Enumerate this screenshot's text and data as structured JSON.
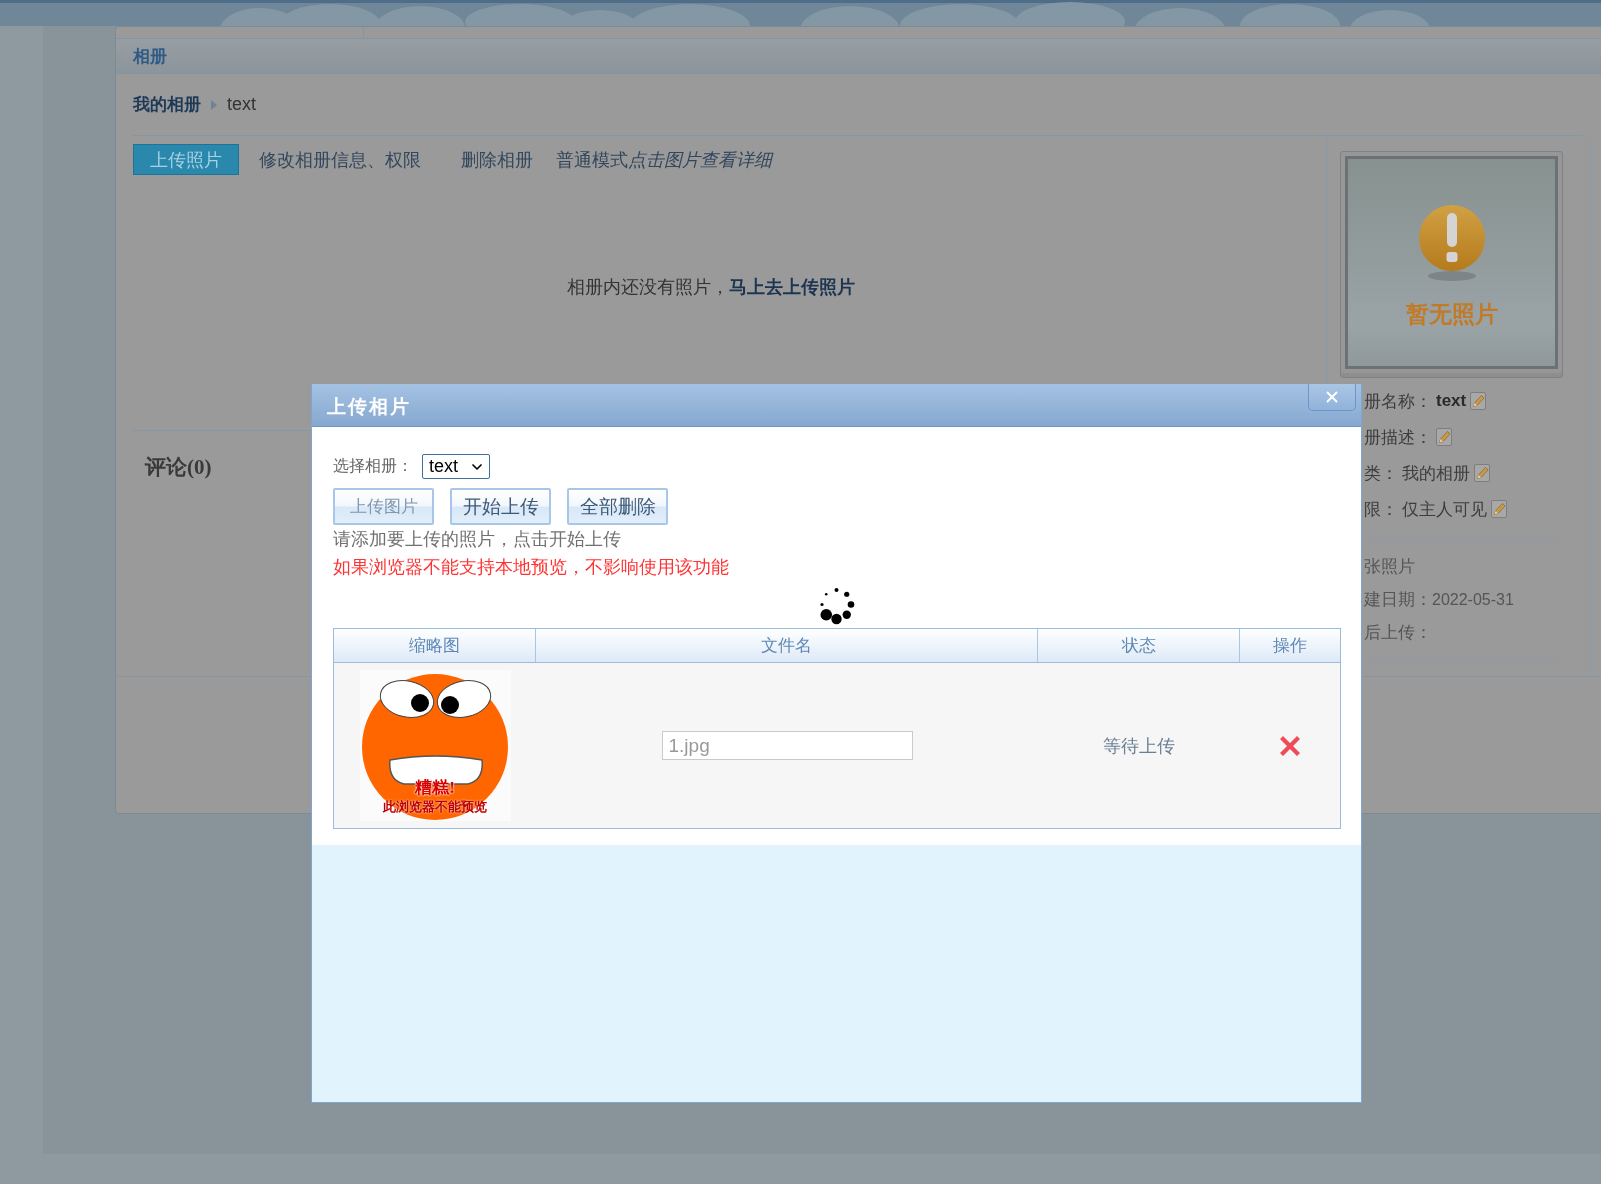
{
  "section_title": "相册",
  "breadcrumb": [
    {
      "label": "我的相册",
      "kind": "link"
    },
    {
      "label": "text",
      "kind": "current"
    }
  ],
  "tabs": [
    {
      "label": "上传照片",
      "selected": true
    },
    {
      "label": "修改相册信息、权限",
      "selected": false
    },
    {
      "label": "删除相册",
      "selected": false
    }
  ],
  "view_mode": {
    "label": "普通模式",
    "hint": "点击图片查看详细"
  },
  "empty_message": {
    "text": "相册内还没有照片，",
    "link": "马上去上传照片"
  },
  "comments": {
    "heading": "评论(0)"
  },
  "album_cover": {
    "caption": "暂无照片"
  },
  "album_info": [
    {
      "label": "册名称：",
      "value": "text",
      "kind": "name",
      "editable": true
    },
    {
      "label": "册描述：",
      "editable": true
    },
    {
      "label": "类：",
      "value": "我的相册",
      "kind": "plain",
      "editable": true
    },
    {
      "label": "限：",
      "value": "仅主人可见",
      "kind": "plain",
      "editable": true
    }
  ],
  "album_stats": [
    {
      "label": "张照片"
    },
    {
      "label": "建日期：",
      "value": "2022-05-31"
    },
    {
      "label": "后上传："
    }
  ],
  "dialog": {
    "title": "上传相片",
    "album_label": "选择相册：",
    "album_select": {
      "value": "text"
    },
    "buttons": [
      {
        "label": "上传图片",
        "disabled": true
      },
      {
        "label": "开始上传",
        "disabled": false
      },
      {
        "label": "全部删除",
        "disabled": false
      }
    ],
    "hint": "请添加要上传的照片，点击开始上传",
    "warning": "如果浏览器不能支持本地预览，不影响使用该功能",
    "loading": true,
    "table": {
      "columns": [
        "缩略图",
        "文件名",
        "状态",
        "操作"
      ],
      "rows": [
        {
          "thumbnail": {
            "exclaim": "糟糕!",
            "caption": "此浏览器不能预览"
          },
          "file_name": "1.jpg",
          "status": "等待上传"
        }
      ]
    }
  }
}
